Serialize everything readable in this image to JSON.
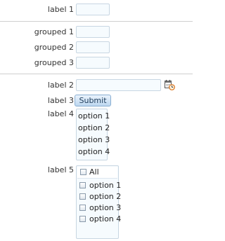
{
  "form": {
    "label1": "label 1",
    "grouped": [
      "grouped 1",
      "grouped 2",
      "grouped 3"
    ],
    "label2": "label 2",
    "label3": "label 3",
    "submit_label": "Submit",
    "label4": "label 4",
    "listbox_options": [
      "option 1",
      "option 2",
      "option 3",
      "option 4"
    ],
    "label5": "label 5",
    "checkbox_all_label": "All",
    "checkbox_options": [
      "option 1",
      "option 2",
      "option 3",
      "option 4"
    ],
    "picker_icon": "calendar-clock-icon"
  }
}
